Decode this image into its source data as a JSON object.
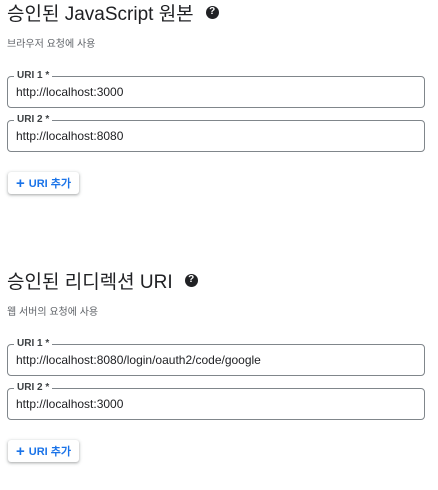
{
  "js_origins": {
    "title": "승인된 JavaScript 원본",
    "description": "브라우저 요청에 사용",
    "uris": [
      {
        "label": "URI 1 *",
        "value": "http://localhost:3000"
      },
      {
        "label": "URI 2 *",
        "value": "http://localhost:8080"
      }
    ],
    "add_button_label": "URI 추가",
    "help_icon": "help-icon"
  },
  "redirect_uris": {
    "title": "승인된 리디렉션 URI",
    "description": "웹 서버의 요청에 사용",
    "uris": [
      {
        "label": "URI 1 *",
        "value": "http://localhost:8080/login/oauth2/code/google"
      },
      {
        "label": "URI 2 *",
        "value": "http://localhost:3000"
      }
    ],
    "add_button_label": "URI 추가",
    "help_icon": "help-icon"
  },
  "colors": {
    "accent": "#1a73e8",
    "text": "#202124",
    "muted": "#5f6368",
    "border": "#80868b"
  }
}
